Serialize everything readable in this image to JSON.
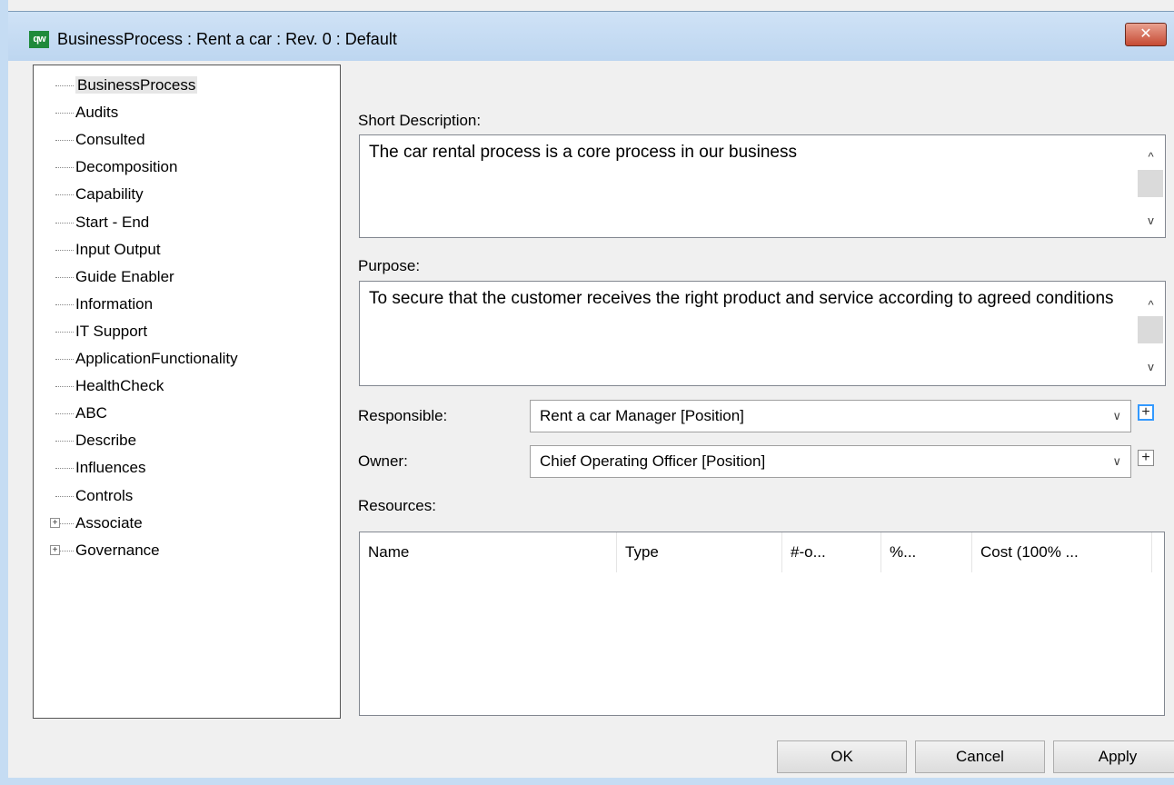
{
  "window": {
    "app_icon_text": "qw",
    "title": "BusinessProcess : Rent a car : Rev. 0  : Default",
    "close_glyph": "✕"
  },
  "tree": {
    "items": [
      {
        "label": "BusinessProcess",
        "selected": true,
        "expandable": false
      },
      {
        "label": "Audits"
      },
      {
        "label": "Consulted"
      },
      {
        "label": "Decomposition"
      },
      {
        "label": "Capability"
      },
      {
        "label": "Start - End"
      },
      {
        "label": "Input Output"
      },
      {
        "label": "Guide Enabler"
      },
      {
        "label": "Information"
      },
      {
        "label": "IT Support"
      },
      {
        "label": "ApplicationFunctionality"
      },
      {
        "label": "HealthCheck"
      },
      {
        "label": "ABC"
      },
      {
        "label": "Describe"
      },
      {
        "label": "Influences"
      },
      {
        "label": "Controls"
      },
      {
        "label": "Associate",
        "expandable": true
      },
      {
        "label": "Governance",
        "expandable": true
      }
    ]
  },
  "form": {
    "short_description_label": "Short Description:",
    "short_description_value": "The car rental process is a core process in our business",
    "purpose_label": "Purpose:",
    "purpose_value": "To secure that the customer receives the right product and service according to agreed conditions",
    "responsible_label": "Responsible:",
    "responsible_value": "Rent a car Manager [Position]",
    "owner_label": "Owner:",
    "owner_value": "Chief Operating Officer [Position]",
    "resources_label": "Resources:",
    "plus_glyph": "+",
    "scroll_up": "^",
    "scroll_down": "v",
    "dropdown_glyph": "∨"
  },
  "resources_table": {
    "columns": [
      "Name",
      "Type",
      "#-o...",
      "%...",
      "Cost (100% ..."
    ],
    "rows": []
  },
  "buttons": {
    "ok": "OK",
    "cancel": "Cancel",
    "apply": "Apply"
  }
}
